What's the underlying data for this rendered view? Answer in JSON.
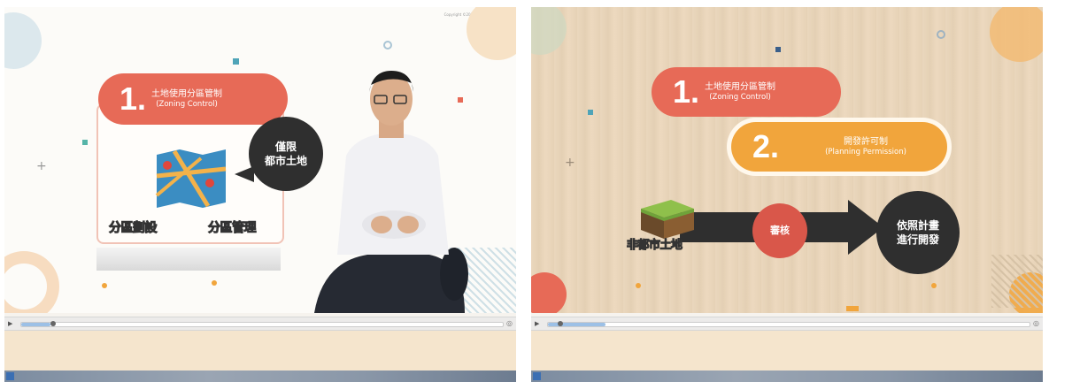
{
  "left_slide": {
    "copyright": "Copyright ©2019 · All rights reserved",
    "pill": {
      "number": "1.",
      "title_zh": "土地使用分區管制",
      "title_en": "(Zoning Control)"
    },
    "bubble": {
      "line1": "僅限",
      "line2": "都市土地"
    },
    "labels": [
      "分區劃設",
      "分區管理"
    ]
  },
  "right_slide": {
    "pill1": {
      "number": "1.",
      "title_zh": "土地使用分區管制",
      "title_en": "(Zoning Control)"
    },
    "pill2": {
      "number": "2.",
      "title_zh": "開發許可制",
      "title_en": "(Planning Permission)"
    },
    "land_label": "非都市土地",
    "review": "審核",
    "result": {
      "line1": "依照計畫",
      "line2": "進行開發"
    }
  },
  "player": {
    "play_icon": "play-icon",
    "volume_icon": "volume-icon",
    "left_progress": 0.06,
    "right_progress": 0.12
  },
  "colors": {
    "red": "#e76a57",
    "orange": "#f1a53c",
    "dark": "#2f2f2f"
  }
}
